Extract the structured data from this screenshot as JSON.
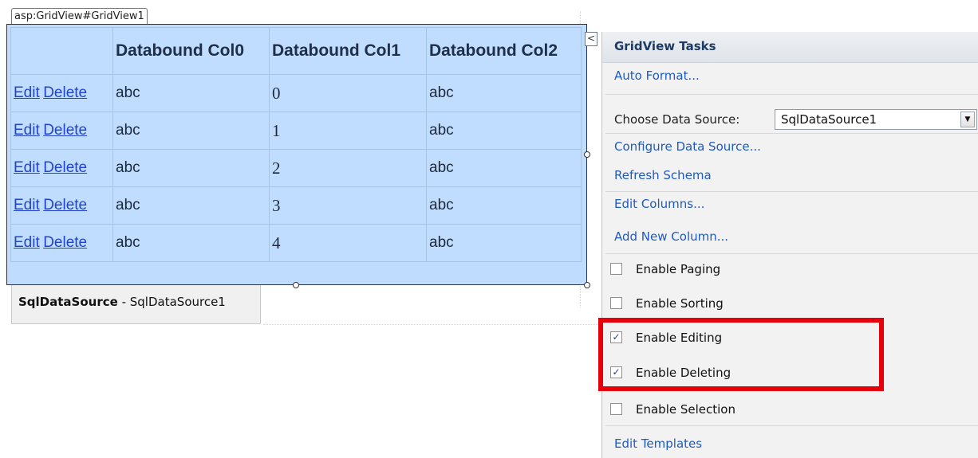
{
  "designer": {
    "control_tag": "asp:GridView#GridView1",
    "grid": {
      "headers": [
        "",
        "Databound Col0",
        "Databound Col1",
        "Databound Col2"
      ],
      "edit_label": "Edit",
      "delete_label": "Delete",
      "rows": [
        {
          "col0": "abc",
          "col1": "0",
          "col2": "abc"
        },
        {
          "col0": "abc",
          "col1": "1",
          "col2": "abc"
        },
        {
          "col0": "abc",
          "col1": "2",
          "col2": "abc"
        },
        {
          "col0": "abc",
          "col1": "3",
          "col2": "abc"
        },
        {
          "col0": "abc",
          "col1": "4",
          "col2": "abc"
        }
      ]
    },
    "sqldatasource": {
      "type": "SqlDataSource",
      "separator": " - ",
      "name": "SqlDataSource1"
    },
    "collapse_glyph": "<"
  },
  "tasks_panel": {
    "title": "GridView Tasks",
    "auto_format": "Auto Format...",
    "choose_data_source_label": "Choose Data Source:",
    "data_source_value": "SqlDataSource1",
    "dropdown_glyph": "▼",
    "configure_data_source": "Configure Data Source...",
    "refresh_schema": "Refresh Schema",
    "edit_columns": "Edit Columns...",
    "add_new_column": "Add New Column...",
    "options": [
      {
        "label": "Enable Paging",
        "checked": false
      },
      {
        "label": "Enable Sorting",
        "checked": false
      },
      {
        "label": "Enable Editing",
        "checked": true
      },
      {
        "label": "Enable Deleting",
        "checked": true
      },
      {
        "label": "Enable Selection",
        "checked": false
      }
    ],
    "edit_templates": "Edit Templates",
    "check_glyph": "✓"
  },
  "colors": {
    "grid_background": "#c0ddff",
    "link": "#2244cc",
    "task_link": "#1e5bbf",
    "highlight": "#e6000b"
  }
}
